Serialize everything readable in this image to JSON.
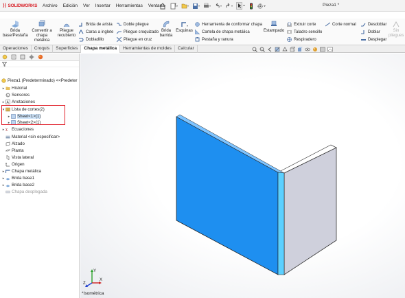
{
  "app": {
    "brand": "SOLIDWORKS",
    "doc_title": "Pieza1 *",
    "menu": [
      "Archivo",
      "Edición",
      "Ver",
      "Insertar",
      "Herramientas",
      "Ventana"
    ]
  },
  "ribbon": {
    "brida_base": "Brida base/Pestaña",
    "convertir": "Convertir a chapa metálica",
    "pliegue_recubierto": "Pliegue recubierto",
    "brida_arista": "Brida de arista",
    "caras_inglete": "Caras a inglete",
    "dobladillo": "Dobladillo",
    "doble_pliegue": "Doble pliegue",
    "pliegue_croquizado": "Pliegue croquizado",
    "pliegue_cruz": "Pliegue en cruz",
    "brida_barrida": "Brida barrida",
    "esquinas": "Esquinas",
    "herr_conformar": "Herramienta de conformar chapa",
    "cartela": "Cartela de chapa metálica",
    "pestana_ranura": "Pestaña y ranura",
    "estampado": "Estampado",
    "extruir_corte": "Extruir corte",
    "taladro_sencillo": "Taladro sencillo",
    "respiradero": "Respiradero",
    "corte_normal": "Corte normal",
    "desdoblar": "Desdoblar",
    "doblar": "Doblar",
    "desplegar": "Desplegar",
    "sin_pliegues": "Sin pliegues"
  },
  "tabs": [
    "Operaciones",
    "Croquis",
    "Superficies",
    "Chapa metálica",
    "Herramientas de moldes",
    "Calcular"
  ],
  "active_tab": "Chapa metálica",
  "tree": {
    "root": "Pieza1 (Predeterminado) <<Predeter",
    "historial": "Historial",
    "sensores": "Sensores",
    "anotaciones": "Anotaciones",
    "lista_cortes": "Lista de cortes(2)",
    "sheet1": "Sheet<1>(1)",
    "sheet2": "Sheet<2>(1)",
    "ecuaciones": "Ecuaciones",
    "material": "Material <sin especificar>",
    "alzado": "Alzado",
    "planta": "Planta",
    "vista_lateral": "Vista lateral",
    "origen": "Origen",
    "chapa_metalica": "Chapa metálica",
    "brida_base1": "Brida base1",
    "brida_base2": "Brida base2",
    "chapa_desplegada": "Chapa desplegada"
  },
  "viewport": {
    "view_label": "*Isométrica",
    "triad_x": "X",
    "triad_y": "Y",
    "triad_z": "Z"
  },
  "colors": {
    "accent_blue": "#1e8ff0",
    "selection": "#cfe5fb",
    "annotation_red": "#e0202a",
    "grey_face": "#cfd0dc"
  }
}
